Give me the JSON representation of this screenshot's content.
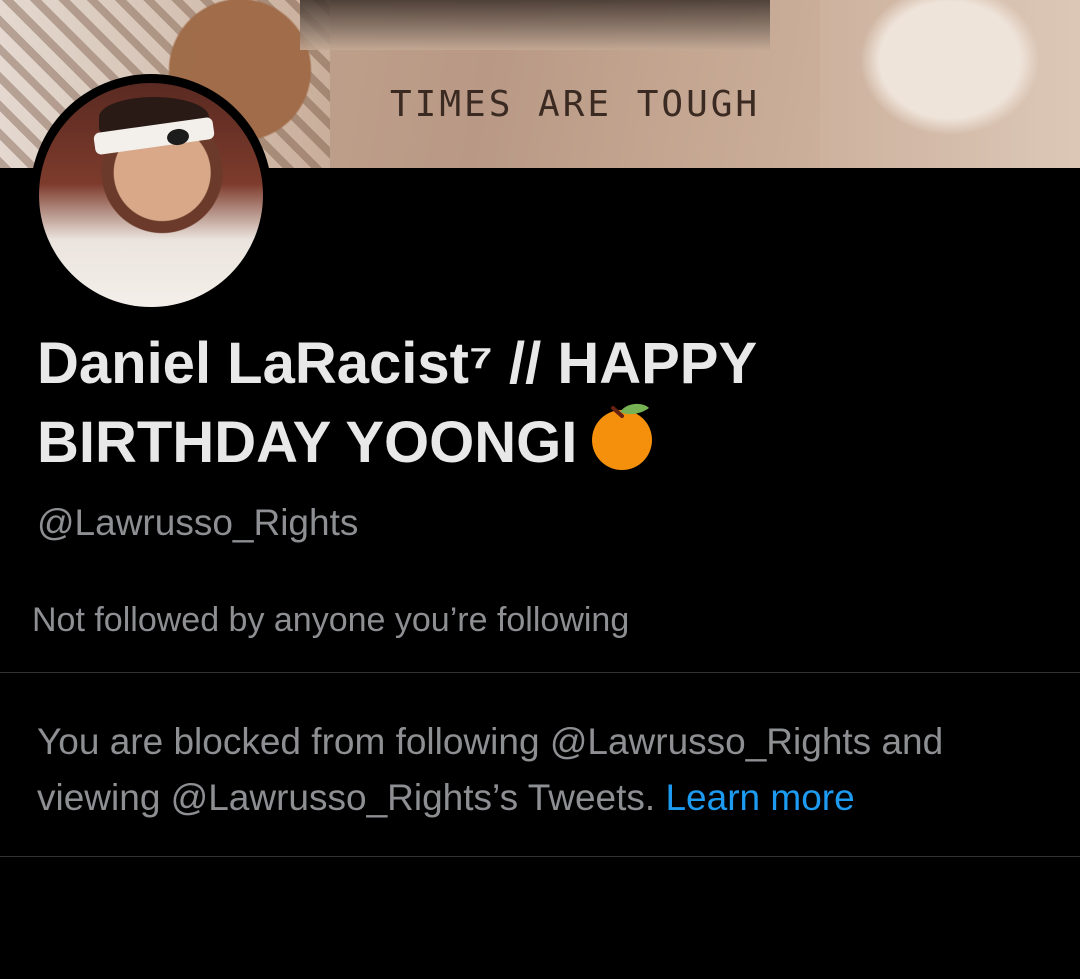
{
  "banner": {
    "text": "TIMES ARE TOUGH"
  },
  "profile": {
    "display_name_line1": "Daniel LaRacist⁷ // HAPPY",
    "display_name_line2": "BIRTHDAY YOONGI",
    "handle": "@Lawrusso_Rights",
    "followers_note": "Not followed by anyone you’re following",
    "emoji_icon": "orange-icon"
  },
  "blocked": {
    "message": "You are blocked from following @Lawrusso_Rights and viewing @Lawrusso_Rights’s Tweets.",
    "link_label": "Learn more"
  },
  "colors": {
    "background": "#000000",
    "text_primary": "#e8e8e8",
    "text_secondary": "#8d8f92",
    "link": "#1d9bf0",
    "divider": "#2f3336"
  }
}
